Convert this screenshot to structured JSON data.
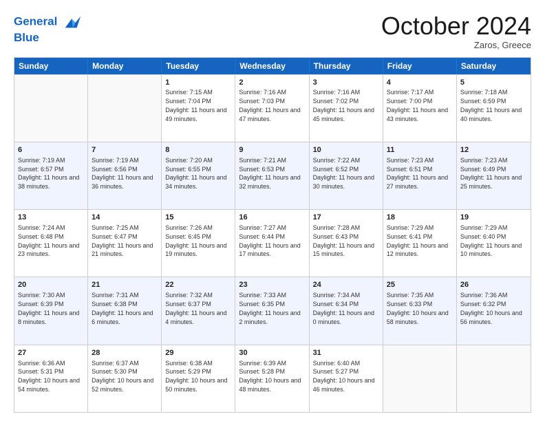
{
  "header": {
    "logo_line1": "General",
    "logo_line2": "Blue",
    "month": "October 2024",
    "location": "Zaros, Greece"
  },
  "days_of_week": [
    "Sunday",
    "Monday",
    "Tuesday",
    "Wednesday",
    "Thursday",
    "Friday",
    "Saturday"
  ],
  "weeks": [
    [
      {
        "day": "",
        "sunrise": "",
        "sunset": "",
        "daylight": "",
        "empty": true
      },
      {
        "day": "",
        "sunrise": "",
        "sunset": "",
        "daylight": "",
        "empty": true
      },
      {
        "day": "1",
        "sunrise": "Sunrise: 7:15 AM",
        "sunset": "Sunset: 7:04 PM",
        "daylight": "Daylight: 11 hours and 49 minutes."
      },
      {
        "day": "2",
        "sunrise": "Sunrise: 7:16 AM",
        "sunset": "Sunset: 7:03 PM",
        "daylight": "Daylight: 11 hours and 47 minutes."
      },
      {
        "day": "3",
        "sunrise": "Sunrise: 7:16 AM",
        "sunset": "Sunset: 7:02 PM",
        "daylight": "Daylight: 11 hours and 45 minutes."
      },
      {
        "day": "4",
        "sunrise": "Sunrise: 7:17 AM",
        "sunset": "Sunset: 7:00 PM",
        "daylight": "Daylight: 11 hours and 43 minutes."
      },
      {
        "day": "5",
        "sunrise": "Sunrise: 7:18 AM",
        "sunset": "Sunset: 6:59 PM",
        "daylight": "Daylight: 11 hours and 40 minutes."
      }
    ],
    [
      {
        "day": "6",
        "sunrise": "Sunrise: 7:19 AM",
        "sunset": "Sunset: 6:57 PM",
        "daylight": "Daylight: 11 hours and 38 minutes."
      },
      {
        "day": "7",
        "sunrise": "Sunrise: 7:19 AM",
        "sunset": "Sunset: 6:56 PM",
        "daylight": "Daylight: 11 hours and 36 minutes."
      },
      {
        "day": "8",
        "sunrise": "Sunrise: 7:20 AM",
        "sunset": "Sunset: 6:55 PM",
        "daylight": "Daylight: 11 hours and 34 minutes."
      },
      {
        "day": "9",
        "sunrise": "Sunrise: 7:21 AM",
        "sunset": "Sunset: 6:53 PM",
        "daylight": "Daylight: 11 hours and 32 minutes."
      },
      {
        "day": "10",
        "sunrise": "Sunrise: 7:22 AM",
        "sunset": "Sunset: 6:52 PM",
        "daylight": "Daylight: 11 hours and 30 minutes."
      },
      {
        "day": "11",
        "sunrise": "Sunrise: 7:23 AM",
        "sunset": "Sunset: 6:51 PM",
        "daylight": "Daylight: 11 hours and 27 minutes."
      },
      {
        "day": "12",
        "sunrise": "Sunrise: 7:23 AM",
        "sunset": "Sunset: 6:49 PM",
        "daylight": "Daylight: 11 hours and 25 minutes."
      }
    ],
    [
      {
        "day": "13",
        "sunrise": "Sunrise: 7:24 AM",
        "sunset": "Sunset: 6:48 PM",
        "daylight": "Daylight: 11 hours and 23 minutes."
      },
      {
        "day": "14",
        "sunrise": "Sunrise: 7:25 AM",
        "sunset": "Sunset: 6:47 PM",
        "daylight": "Daylight: 11 hours and 21 minutes."
      },
      {
        "day": "15",
        "sunrise": "Sunrise: 7:26 AM",
        "sunset": "Sunset: 6:45 PM",
        "daylight": "Daylight: 11 hours and 19 minutes."
      },
      {
        "day": "16",
        "sunrise": "Sunrise: 7:27 AM",
        "sunset": "Sunset: 6:44 PM",
        "daylight": "Daylight: 11 hours and 17 minutes."
      },
      {
        "day": "17",
        "sunrise": "Sunrise: 7:28 AM",
        "sunset": "Sunset: 6:43 PM",
        "daylight": "Daylight: 11 hours and 15 minutes."
      },
      {
        "day": "18",
        "sunrise": "Sunrise: 7:29 AM",
        "sunset": "Sunset: 6:41 PM",
        "daylight": "Daylight: 11 hours and 12 minutes."
      },
      {
        "day": "19",
        "sunrise": "Sunrise: 7:29 AM",
        "sunset": "Sunset: 6:40 PM",
        "daylight": "Daylight: 11 hours and 10 minutes."
      }
    ],
    [
      {
        "day": "20",
        "sunrise": "Sunrise: 7:30 AM",
        "sunset": "Sunset: 6:39 PM",
        "daylight": "Daylight: 11 hours and 8 minutes."
      },
      {
        "day": "21",
        "sunrise": "Sunrise: 7:31 AM",
        "sunset": "Sunset: 6:38 PM",
        "daylight": "Daylight: 11 hours and 6 minutes."
      },
      {
        "day": "22",
        "sunrise": "Sunrise: 7:32 AM",
        "sunset": "Sunset: 6:37 PM",
        "daylight": "Daylight: 11 hours and 4 minutes."
      },
      {
        "day": "23",
        "sunrise": "Sunrise: 7:33 AM",
        "sunset": "Sunset: 6:35 PM",
        "daylight": "Daylight: 11 hours and 2 minutes."
      },
      {
        "day": "24",
        "sunrise": "Sunrise: 7:34 AM",
        "sunset": "Sunset: 6:34 PM",
        "daylight": "Daylight: 11 hours and 0 minutes."
      },
      {
        "day": "25",
        "sunrise": "Sunrise: 7:35 AM",
        "sunset": "Sunset: 6:33 PM",
        "daylight": "Daylight: 10 hours and 58 minutes."
      },
      {
        "day": "26",
        "sunrise": "Sunrise: 7:36 AM",
        "sunset": "Sunset: 6:32 PM",
        "daylight": "Daylight: 10 hours and 56 minutes."
      }
    ],
    [
      {
        "day": "27",
        "sunrise": "Sunrise: 6:36 AM",
        "sunset": "Sunset: 5:31 PM",
        "daylight": "Daylight: 10 hours and 54 minutes."
      },
      {
        "day": "28",
        "sunrise": "Sunrise: 6:37 AM",
        "sunset": "Sunset: 5:30 PM",
        "daylight": "Daylight: 10 hours and 52 minutes."
      },
      {
        "day": "29",
        "sunrise": "Sunrise: 6:38 AM",
        "sunset": "Sunset: 5:29 PM",
        "daylight": "Daylight: 10 hours and 50 minutes."
      },
      {
        "day": "30",
        "sunrise": "Sunrise: 6:39 AM",
        "sunset": "Sunset: 5:28 PM",
        "daylight": "Daylight: 10 hours and 48 minutes."
      },
      {
        "day": "31",
        "sunrise": "Sunrise: 6:40 AM",
        "sunset": "Sunset: 5:27 PM",
        "daylight": "Daylight: 10 hours and 46 minutes."
      },
      {
        "day": "",
        "sunrise": "",
        "sunset": "",
        "daylight": "",
        "empty": true
      },
      {
        "day": "",
        "sunrise": "",
        "sunset": "",
        "daylight": "",
        "empty": true
      }
    ]
  ]
}
